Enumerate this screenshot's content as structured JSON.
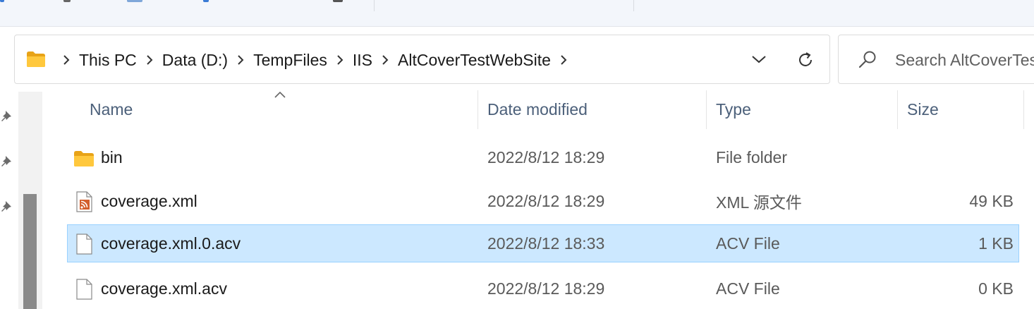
{
  "address": {
    "breadcrumbs": [
      "This PC",
      "Data (D:)",
      "TempFiles",
      "IIS",
      "AltCoverTestWebSite"
    ]
  },
  "search": {
    "placeholder": "Search AltCoverTestWebSite"
  },
  "columns": {
    "name": "Name",
    "date": "Date modified",
    "type": "Type",
    "size": "Size"
  },
  "files": [
    {
      "name": "bin",
      "date": "2022/8/12 18:29",
      "type": "File folder",
      "size": "",
      "icon": "folder-icon",
      "selected": false
    },
    {
      "name": "coverage.xml",
      "date": "2022/8/12 18:29",
      "type": "XML 源文件",
      "size": "49 KB",
      "icon": "xml-file-icon",
      "selected": false
    },
    {
      "name": "coverage.xml.0.acv",
      "date": "2022/8/12 18:33",
      "type": "ACV File",
      "size": "1 KB",
      "icon": "file-icon",
      "selected": true
    },
    {
      "name": "coverage.xml.acv",
      "date": "2022/8/12 18:29",
      "type": "ACV File",
      "size": "0 KB",
      "icon": "file-icon",
      "selected": false
    }
  ],
  "colors": {
    "selection": "#cce8ff",
    "selection_border": "#99d1ff",
    "header_text": "#4c607a",
    "folder": "#ffc83d"
  }
}
